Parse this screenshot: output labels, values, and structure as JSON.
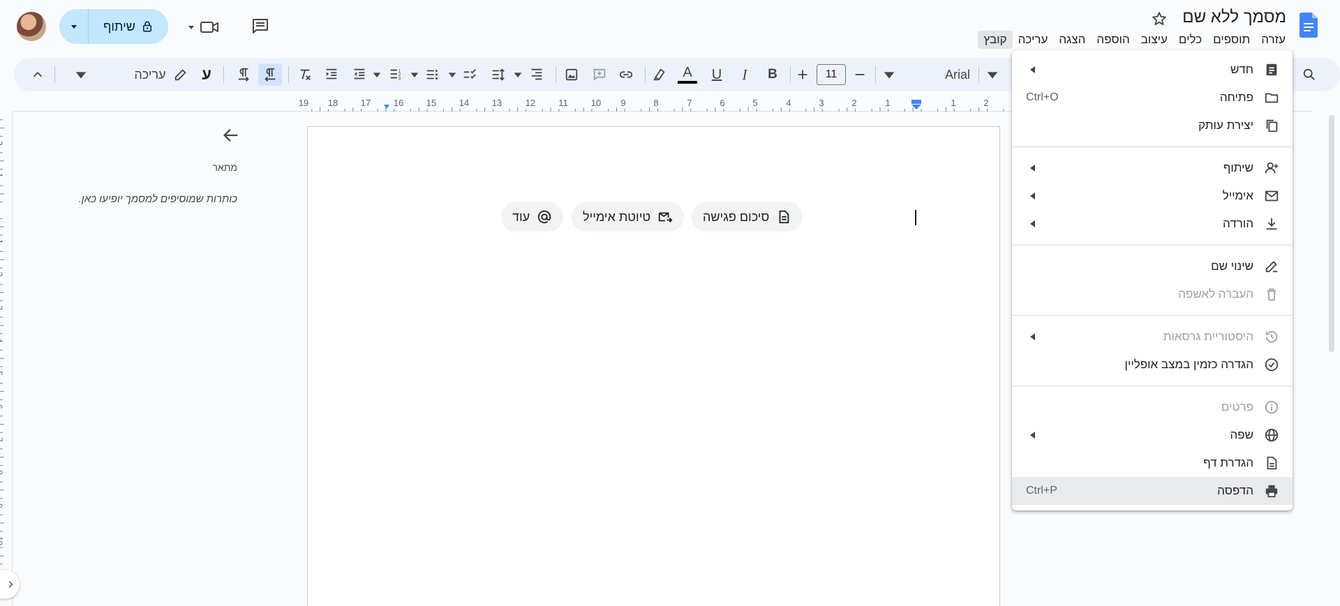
{
  "header": {
    "doc_title": "מסמך ללא שם",
    "menus": [
      "קובץ",
      "עריכה",
      "הצגה",
      "הוספה",
      "עיצוב",
      "כלים",
      "תוספים",
      "עזרה"
    ],
    "share_label": "שיתוף",
    "accent_color": "#c2e7ff"
  },
  "toolbar": {
    "font_name": "Arial",
    "font_size": "11",
    "bold_label": "B",
    "italic_label": "I",
    "underline_label": "U",
    "text_color_label": "A",
    "edit_mode_label": "עריכה",
    "rtl_glyph": "ע"
  },
  "ruler": {
    "numbers": [
      "19",
      "18",
      "17",
      "16",
      "15",
      "14",
      "13",
      "12",
      "11",
      "10",
      "9",
      "8",
      "7",
      "6",
      "5",
      "4",
      "3",
      "2",
      "1",
      "1",
      "2"
    ],
    "vertical_numbers": [
      "2",
      "1",
      "1",
      "2",
      "3",
      "4",
      "5",
      "6",
      "7",
      "8",
      "9",
      "10"
    ]
  },
  "outline": {
    "heading": "מתאר",
    "hint": "כותרות שמוסיפים למסמך יופיעו כאן."
  },
  "chips": {
    "meeting_notes": "סיכום פגישה",
    "email_draft": "טיוטת אימייל",
    "more": "עוד"
  },
  "file_menu": {
    "new": "חדש",
    "open": "פתיחה",
    "open_shortcut": "Ctrl+O",
    "copy": "יצירת עותק",
    "share": "שיתוף",
    "email": "אימייל",
    "download": "הורדה",
    "rename": "שינוי שם",
    "trash": "העברה לאשפה",
    "version_history": "היסטוריית גרסאות",
    "offline": "הגדרה כזמין במצב אופליין",
    "details": "פרטים",
    "language": "שפה",
    "page_setup": "הגדרת דף",
    "print": "הדפסה",
    "print_shortcut": "Ctrl+P"
  }
}
